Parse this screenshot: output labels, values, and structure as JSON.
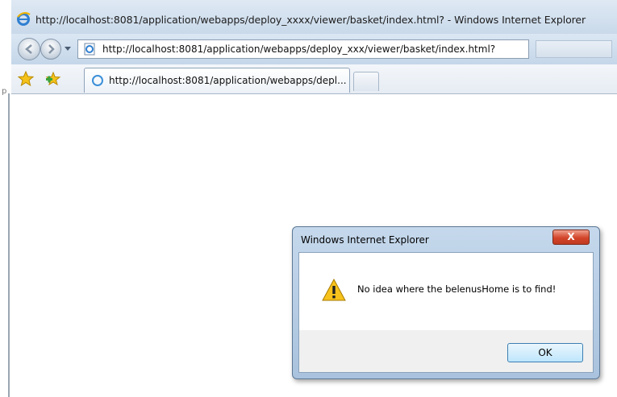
{
  "window": {
    "title": "http://localhost:8081/application/webapps/deploy_xxxx/viewer/basket/index.html? - Windows Internet Explorer"
  },
  "address_bar": {
    "url": "http://localhost:8081/application/webapps/deploy_xxx/viewer/basket/index.html?"
  },
  "tabs": [
    {
      "label": "http://localhost:8081/application/webapps/depl..."
    }
  ],
  "left_margin": {
    "stray_char": "p"
  },
  "dialog": {
    "title": "Windows Internet Explorer",
    "close_label": "X",
    "message": "No idea where the belenusHome is to find!",
    "ok_label": "OK"
  },
  "icons": {
    "browser": "ie-logo-icon",
    "back": "back-arrow-icon",
    "forward": "forward-arrow-icon",
    "page": "page-icon",
    "favorites": "favorites-star-icon",
    "add_favorites": "add-favorites-icon",
    "tab_loading": "loading-icon",
    "warning": "warning-icon"
  },
  "colors": {
    "close_button": "#d2452a",
    "ok_border": "#3c7fb1",
    "chrome": "#c9d9ea"
  }
}
